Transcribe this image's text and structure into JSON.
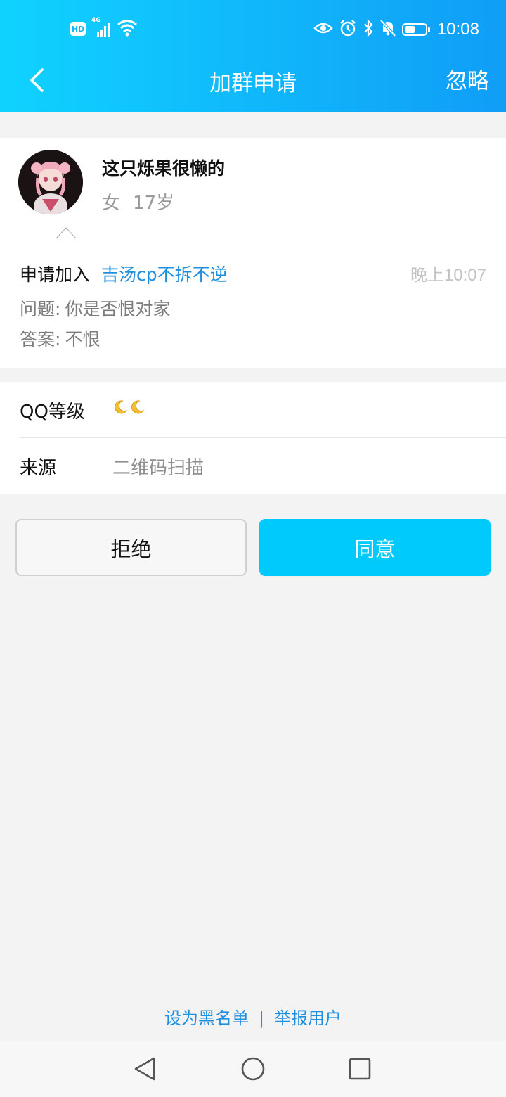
{
  "status_bar": {
    "left_icons": [
      "hd-icon",
      "4g-signal-icon",
      "wifi-icon"
    ],
    "hd_label": "HD",
    "network_label": "4G",
    "right_icons": [
      "eye-icon",
      "alarm-icon",
      "bluetooth-icon",
      "mute-bell-icon",
      "battery-icon"
    ],
    "battery_level": 0.5,
    "time": "10:08"
  },
  "header": {
    "title": "加群申请",
    "ignore_label": "忽略",
    "back_icon": "chevron-left-icon"
  },
  "user": {
    "name": "这只烁果很懒的",
    "gender": "女",
    "age": "17岁"
  },
  "request": {
    "prefix": "申请加入",
    "group_name": "吉汤cp不拆不逆",
    "time": "晚上10:07",
    "question_label": "问题:",
    "question": "你是否恨对家",
    "answer_label": "答案:",
    "answer": "不恨"
  },
  "info": {
    "level_label": "QQ等级",
    "level_icons": [
      "moon-icon",
      "moon-icon"
    ],
    "source_label": "来源",
    "source_value": "二维码扫描"
  },
  "actions": {
    "reject_label": "拒绝",
    "accept_label": "同意"
  },
  "footer": {
    "blacklist_label": "设为黑名单",
    "separator": "|",
    "report_label": "举报用户"
  },
  "system_nav": {
    "buttons": [
      "back-triangle-icon",
      "home-circle-icon",
      "recents-square-icon"
    ]
  },
  "colors": {
    "header_gradient_start": "#0fd3ff",
    "header_gradient_end": "#109df7",
    "accent_button": "#00cafc",
    "link_blue": "#1f8fe0"
  }
}
